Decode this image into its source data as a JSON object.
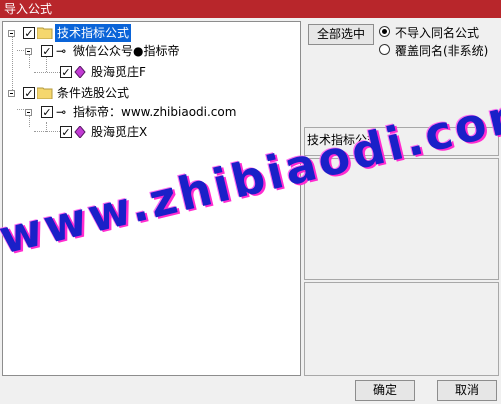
{
  "window": {
    "title": "导入公式"
  },
  "tree": {
    "nodes": [
      {
        "label": "技术指标公式",
        "type": "folder",
        "checked": true,
        "selected": true
      },
      {
        "label": "微信公众号●指标帝",
        "type": "key",
        "checked": true
      },
      {
        "label": "股海觅庄F",
        "type": "diamond",
        "checked": true
      },
      {
        "label": "条件选股公式",
        "type": "folder",
        "checked": true
      },
      {
        "label": "指标帝：www.zhibiaodi.com",
        "type": "key",
        "checked": true
      },
      {
        "label": "股海觅庄X",
        "type": "diamond",
        "checked": true
      }
    ]
  },
  "right": {
    "select_all": "全部选中",
    "options": [
      {
        "label": "不导入同名公式",
        "selected": true
      },
      {
        "label": "覆盖同名(非系统)",
        "selected": false
      }
    ],
    "info_header": "技术指标公式"
  },
  "footer": {
    "ok": "确定",
    "cancel": "取消"
  },
  "watermark": {
    "text": "www.zhibiaodi.com"
  },
  "colors": {
    "title_bar": "#b8262b",
    "selection": "#0a64d8",
    "watermark": "#1a20c8"
  }
}
